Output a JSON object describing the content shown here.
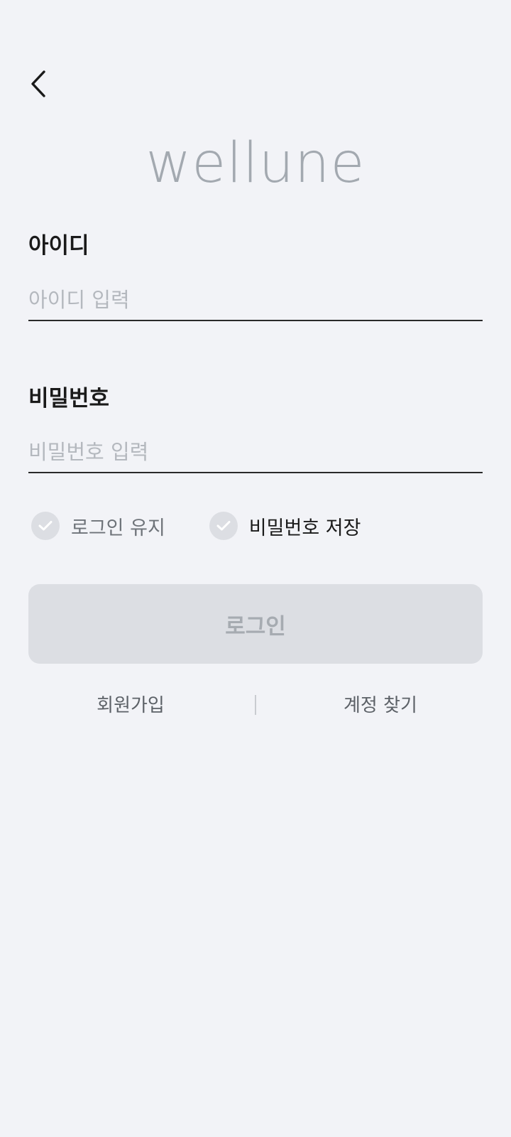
{
  "header": {
    "back_icon": "chevron-left-icon"
  },
  "logo": {
    "text": "wellune"
  },
  "form": {
    "id_label": "아이디",
    "id_placeholder": "아이디 입력",
    "id_value": "",
    "pw_label": "비밀번호",
    "pw_placeholder": "비밀번호 입력",
    "pw_value": ""
  },
  "options": {
    "keep_login_label": "로그인 유지",
    "keep_login_checked": false,
    "save_pw_label": "비밀번호 저장",
    "save_pw_checked": false,
    "check_icon": "checkmark-icon"
  },
  "actions": {
    "login_label": "로그인",
    "signup_label": "회원가입",
    "find_account_label": "계정 찾기"
  },
  "colors": {
    "background": "#f2f3f7",
    "logo": "#a3a9b0",
    "button_disabled_bg": "#dcdee3",
    "button_disabled_text": "#a6abb1",
    "text_primary": "#1a1a1a",
    "placeholder": "#b4b8be"
  }
}
